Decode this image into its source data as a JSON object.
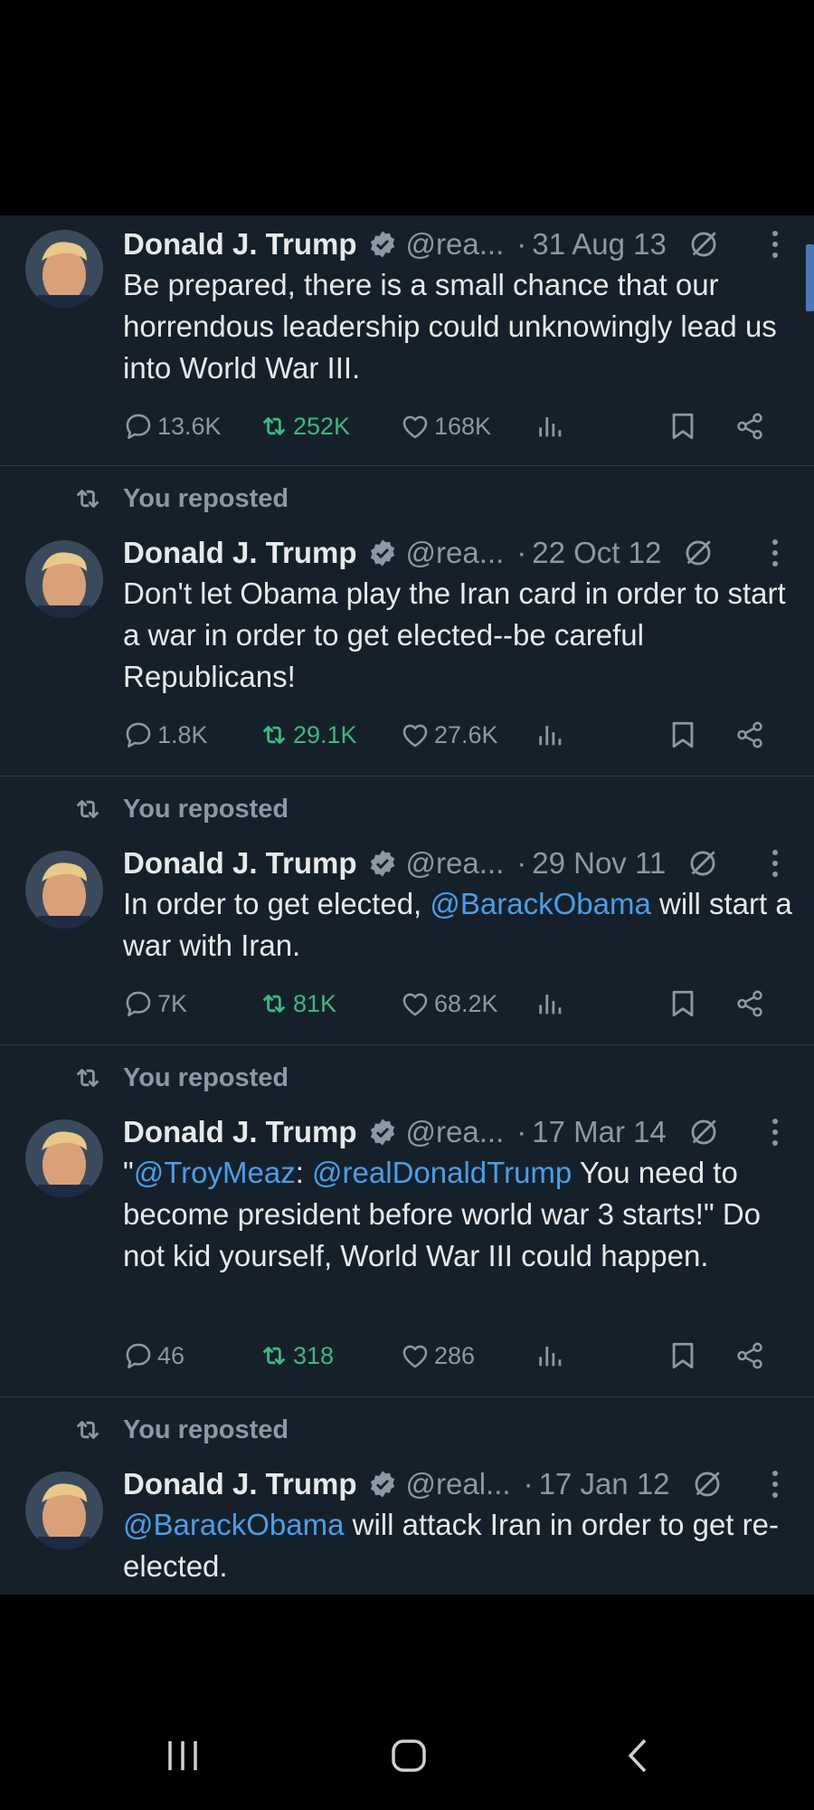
{
  "scrollbar_color": "#4a78b8",
  "tweets": [
    {
      "reposted_label": "",
      "name": "Donald J. Trump",
      "handle": "@rea...",
      "date": "31 Aug 13",
      "text_parts": [
        "Be prepared, there is a small chance that our horrendous leadership could unknowingly lead us into World War III."
      ],
      "replies": "13.6K",
      "reposts": "252K",
      "likes": "168K"
    },
    {
      "reposted_label": "You reposted",
      "name": "Donald J. Trump",
      "handle": "@rea...",
      "date": "22 Oct 12",
      "text_parts": [
        "Don't let Obama play the Iran card in order to start a war in order to get elected--be careful Republicans!"
      ],
      "replies": "1.8K",
      "reposts": "29.1K",
      "likes": "27.6K"
    },
    {
      "reposted_label": "You reposted",
      "name": "Donald J. Trump",
      "handle": "@rea...",
      "date": "29 Nov 11",
      "text_parts": [
        "In order to get elected, ",
        "@BarackObama",
        " will start a war with Iran."
      ],
      "replies": "7K",
      "reposts": "81K",
      "likes": "68.2K"
    },
    {
      "reposted_label": "You reposted",
      "name": "Donald J. Trump",
      "handle": "@rea...",
      "date": "17 Mar 14",
      "text_parts": [
        "\"",
        "@TroyMeaz",
        ": ",
        "@realDonaldTrump",
        " You need to become president before world war 3 starts!\" Do not kid yourself, World War III could happen."
      ],
      "replies": "46",
      "reposts": "318",
      "likes": "286"
    },
    {
      "reposted_label": "You reposted",
      "name": "Donald J. Trump",
      "handle": "@real...",
      "date": "17 Jan 12",
      "text_parts": [
        "@BarackObama",
        " will attack Iran in order to get re-elected."
      ]
    }
  ],
  "nav": {
    "recents": "recent-apps-icon",
    "home": "home-icon",
    "back": "back-icon"
  }
}
